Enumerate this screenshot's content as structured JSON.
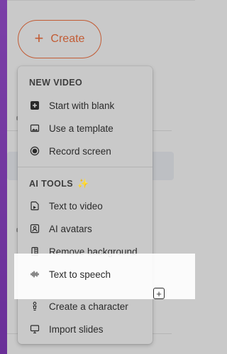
{
  "create_button": {
    "label": "Create",
    "plus": "+"
  },
  "menu": {
    "new_video": {
      "title": "NEW VIDEO",
      "items": [
        {
          "label": "Start with blank",
          "icon": "plus-square-icon"
        },
        {
          "label": "Use a template",
          "icon": "image-icon"
        },
        {
          "label": "Record screen",
          "icon": "record-icon"
        }
      ]
    },
    "ai_tools": {
      "title": "AI TOOLS",
      "icon": "sparkle-icon",
      "items": [
        {
          "label": "Text to video",
          "icon": "text-to-video-icon"
        },
        {
          "label": "AI avatars",
          "icon": "avatar-icon"
        },
        {
          "label": "Remove background",
          "icon": "remove-background-icon"
        },
        {
          "label": "Text to speech",
          "icon": "waveform-icon"
        },
        {
          "label": "Create a character",
          "icon": "character-icon"
        },
        {
          "label": "Import slides",
          "icon": "slides-icon"
        }
      ]
    }
  },
  "floating_add": {
    "label": "+"
  },
  "colors": {
    "accent": "#c25c35",
    "sparkle": "#e0a640",
    "sidebar": "#7b3fa7"
  }
}
